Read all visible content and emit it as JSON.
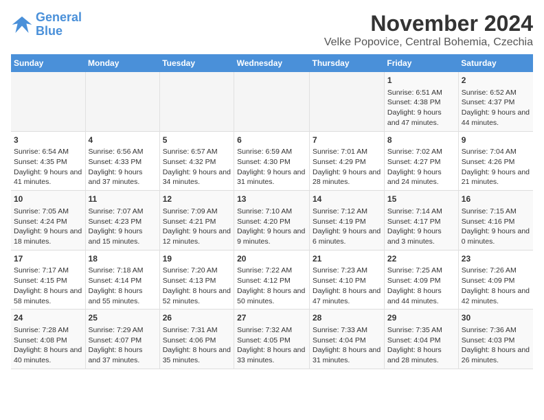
{
  "logo": {
    "line1": "General",
    "line2": "Blue"
  },
  "title": "November 2024",
  "subtitle": "Velke Popovice, Central Bohemia, Czechia",
  "days_of_week": [
    "Sunday",
    "Monday",
    "Tuesday",
    "Wednesday",
    "Thursday",
    "Friday",
    "Saturday"
  ],
  "weeks": [
    [
      {
        "day": "",
        "info": ""
      },
      {
        "day": "",
        "info": ""
      },
      {
        "day": "",
        "info": ""
      },
      {
        "day": "",
        "info": ""
      },
      {
        "day": "",
        "info": ""
      },
      {
        "day": "1",
        "info": "Sunrise: 6:51 AM\nSunset: 4:38 PM\nDaylight: 9 hours and 47 minutes."
      },
      {
        "day": "2",
        "info": "Sunrise: 6:52 AM\nSunset: 4:37 PM\nDaylight: 9 hours and 44 minutes."
      }
    ],
    [
      {
        "day": "3",
        "info": "Sunrise: 6:54 AM\nSunset: 4:35 PM\nDaylight: 9 hours and 41 minutes."
      },
      {
        "day": "4",
        "info": "Sunrise: 6:56 AM\nSunset: 4:33 PM\nDaylight: 9 hours and 37 minutes."
      },
      {
        "day": "5",
        "info": "Sunrise: 6:57 AM\nSunset: 4:32 PM\nDaylight: 9 hours and 34 minutes."
      },
      {
        "day": "6",
        "info": "Sunrise: 6:59 AM\nSunset: 4:30 PM\nDaylight: 9 hours and 31 minutes."
      },
      {
        "day": "7",
        "info": "Sunrise: 7:01 AM\nSunset: 4:29 PM\nDaylight: 9 hours and 28 minutes."
      },
      {
        "day": "8",
        "info": "Sunrise: 7:02 AM\nSunset: 4:27 PM\nDaylight: 9 hours and 24 minutes."
      },
      {
        "day": "9",
        "info": "Sunrise: 7:04 AM\nSunset: 4:26 PM\nDaylight: 9 hours and 21 minutes."
      }
    ],
    [
      {
        "day": "10",
        "info": "Sunrise: 7:05 AM\nSunset: 4:24 PM\nDaylight: 9 hours and 18 minutes."
      },
      {
        "day": "11",
        "info": "Sunrise: 7:07 AM\nSunset: 4:23 PM\nDaylight: 9 hours and 15 minutes."
      },
      {
        "day": "12",
        "info": "Sunrise: 7:09 AM\nSunset: 4:21 PM\nDaylight: 9 hours and 12 minutes."
      },
      {
        "day": "13",
        "info": "Sunrise: 7:10 AM\nSunset: 4:20 PM\nDaylight: 9 hours and 9 minutes."
      },
      {
        "day": "14",
        "info": "Sunrise: 7:12 AM\nSunset: 4:19 PM\nDaylight: 9 hours and 6 minutes."
      },
      {
        "day": "15",
        "info": "Sunrise: 7:14 AM\nSunset: 4:17 PM\nDaylight: 9 hours and 3 minutes."
      },
      {
        "day": "16",
        "info": "Sunrise: 7:15 AM\nSunset: 4:16 PM\nDaylight: 9 hours and 0 minutes."
      }
    ],
    [
      {
        "day": "17",
        "info": "Sunrise: 7:17 AM\nSunset: 4:15 PM\nDaylight: 8 hours and 58 minutes."
      },
      {
        "day": "18",
        "info": "Sunrise: 7:18 AM\nSunset: 4:14 PM\nDaylight: 8 hours and 55 minutes."
      },
      {
        "day": "19",
        "info": "Sunrise: 7:20 AM\nSunset: 4:13 PM\nDaylight: 8 hours and 52 minutes."
      },
      {
        "day": "20",
        "info": "Sunrise: 7:22 AM\nSunset: 4:12 PM\nDaylight: 8 hours and 50 minutes."
      },
      {
        "day": "21",
        "info": "Sunrise: 7:23 AM\nSunset: 4:10 PM\nDaylight: 8 hours and 47 minutes."
      },
      {
        "day": "22",
        "info": "Sunrise: 7:25 AM\nSunset: 4:09 PM\nDaylight: 8 hours and 44 minutes."
      },
      {
        "day": "23",
        "info": "Sunrise: 7:26 AM\nSunset: 4:09 PM\nDaylight: 8 hours and 42 minutes."
      }
    ],
    [
      {
        "day": "24",
        "info": "Sunrise: 7:28 AM\nSunset: 4:08 PM\nDaylight: 8 hours and 40 minutes."
      },
      {
        "day": "25",
        "info": "Sunrise: 7:29 AM\nSunset: 4:07 PM\nDaylight: 8 hours and 37 minutes."
      },
      {
        "day": "26",
        "info": "Sunrise: 7:31 AM\nSunset: 4:06 PM\nDaylight: 8 hours and 35 minutes."
      },
      {
        "day": "27",
        "info": "Sunrise: 7:32 AM\nSunset: 4:05 PM\nDaylight: 8 hours and 33 minutes."
      },
      {
        "day": "28",
        "info": "Sunrise: 7:33 AM\nSunset: 4:04 PM\nDaylight: 8 hours and 31 minutes."
      },
      {
        "day": "29",
        "info": "Sunrise: 7:35 AM\nSunset: 4:04 PM\nDaylight: 8 hours and 28 minutes."
      },
      {
        "day": "30",
        "info": "Sunrise: 7:36 AM\nSunset: 4:03 PM\nDaylight: 8 hours and 26 minutes."
      }
    ]
  ]
}
